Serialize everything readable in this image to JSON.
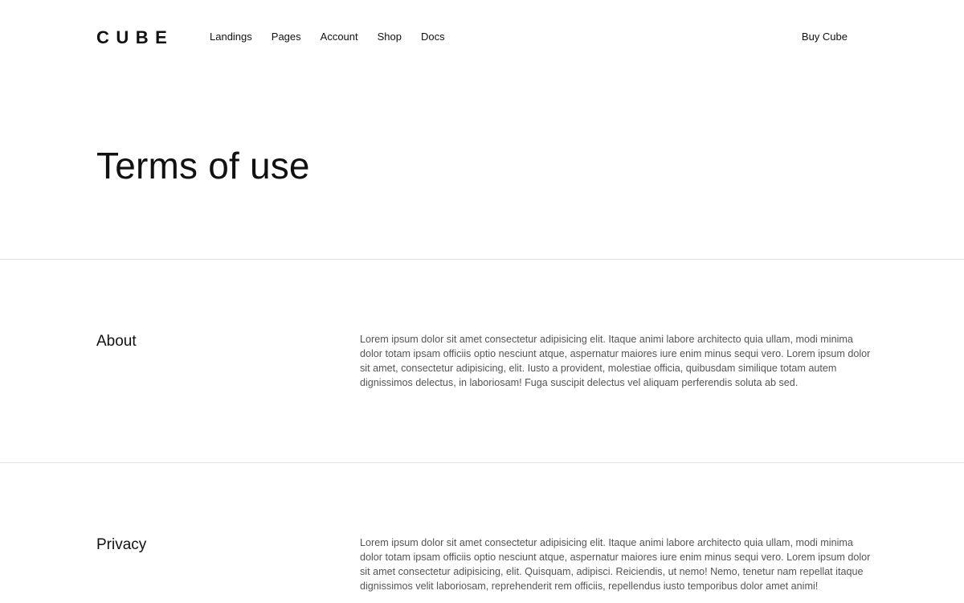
{
  "brand": {
    "logo": "CUBE"
  },
  "nav": {
    "items": [
      "Landings",
      "Pages",
      "Account",
      "Shop",
      "Docs"
    ],
    "cta": "Buy Cube"
  },
  "hero": {
    "title": "Terms of use"
  },
  "sections": [
    {
      "heading": "About",
      "body": "Lorem ipsum dolor sit amet consectetur adipisicing elit. Itaque animi labore architecto quia ullam, modi minima dolor totam ipsam officiis optio nesciunt atque, aspernatur maiores iure enim minus sequi vero. Lorem ipsum dolor sit amet, consectetur adipisicing, elit. Iusto a provident, molestiae officia, quibusdam similique totam autem dignissimos delectus, in laboriosam! Fuga suscipit delectus vel aliquam perferendis soluta ab sed."
    },
    {
      "heading": "Privacy",
      "body": "Lorem ipsum dolor sit amet consectetur adipisicing elit. Itaque animi labore architecto quia ullam, modi minima dolor totam ipsam officiis optio nesciunt atque, aspernatur maiores iure enim minus sequi vero. Lorem ipsum dolor sit amet consectetur adipisicing, elit. Quisquam, adipisci. Reiciendis, ut nemo! Nemo, tenetur nam repellat itaque dignissimos velit laboriosam, reprehenderit rem officiis, repellendus iusto temporibus dolor amet animi!"
    }
  ]
}
